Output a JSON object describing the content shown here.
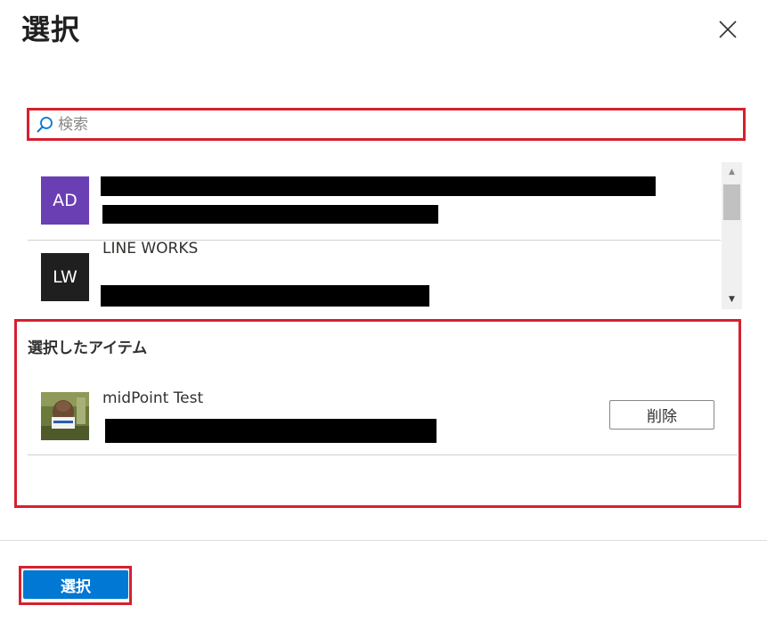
{
  "dialog": {
    "title": "選択",
    "close_icon": "close-icon"
  },
  "search": {
    "placeholder": "検索",
    "value": "",
    "icon": "search-icon"
  },
  "results": [
    {
      "initials": "AD",
      "name": "",
      "avatar_color": "#6b3fb4"
    },
    {
      "initials": "LW",
      "name": "LINE WORKS",
      "avatar_color": "#1f1f1f"
    }
  ],
  "selected": {
    "heading": "選択したアイテム",
    "items": [
      {
        "name": "midPoint Test",
        "remove_label": "削除"
      }
    ]
  },
  "footer": {
    "select_label": "選択"
  },
  "colors": {
    "primary": "#0078d4",
    "highlight_outline": "#d6202f"
  }
}
